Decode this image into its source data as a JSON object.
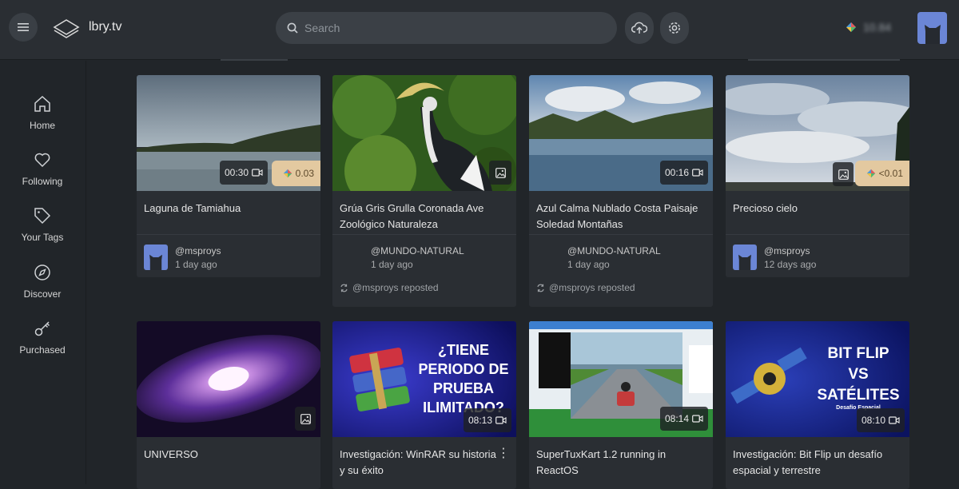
{
  "header": {
    "brand": "lbry.tv",
    "search_placeholder": "Search",
    "balance": "10.84"
  },
  "sidebar": {
    "items": [
      {
        "label": "Home"
      },
      {
        "label": "Following"
      },
      {
        "label": "Your Tags"
      },
      {
        "label": "Discover"
      },
      {
        "label": "Purchased"
      }
    ]
  },
  "cards": [
    {
      "title": "Laguna de Tamiahua",
      "duration": "00:30",
      "price": "0.03",
      "channel": "@msproys",
      "date": "1 day ago"
    },
    {
      "title": "Grúa Gris Grulla Coronada Ave Zoológico Naturaleza",
      "channel": "@MUNDO-NATURAL",
      "date": "1 day ago",
      "repost": "@msproys reposted"
    },
    {
      "title": "Azul Calma Nublado Costa Paisaje Soledad Montañas",
      "duration": "00:16",
      "channel": "@MUNDO-NATURAL",
      "date": "1 day ago",
      "repost": "@msproys reposted"
    },
    {
      "title": "Precioso cielo",
      "price": "<0.01",
      "channel": "@msproys",
      "date": "12 days ago"
    },
    {
      "title": "UNIVERSO"
    },
    {
      "title": "Investigación: WinRAR su historia y su éxito",
      "duration": "08:13",
      "thumb_text": [
        "¿TIENE",
        "PERIODO DE",
        "PRUEBA",
        "ILIMITADO?"
      ]
    },
    {
      "title": "SuperTuxKart 1.2 running in ReactOS",
      "duration": "08:14"
    },
    {
      "title": "Investigación: Bit Flip un desafío espacial y terrestre",
      "duration": "08:10",
      "thumb_text": [
        "BIT FLIP",
        "VS",
        "SATÉLITES",
        "Desafío Espacial"
      ]
    }
  ],
  "colors": {
    "accent_avatar": "#6b86d6",
    "price_bg": "#e3c9a0",
    "bg": "#212529",
    "card": "#2a2e33"
  }
}
